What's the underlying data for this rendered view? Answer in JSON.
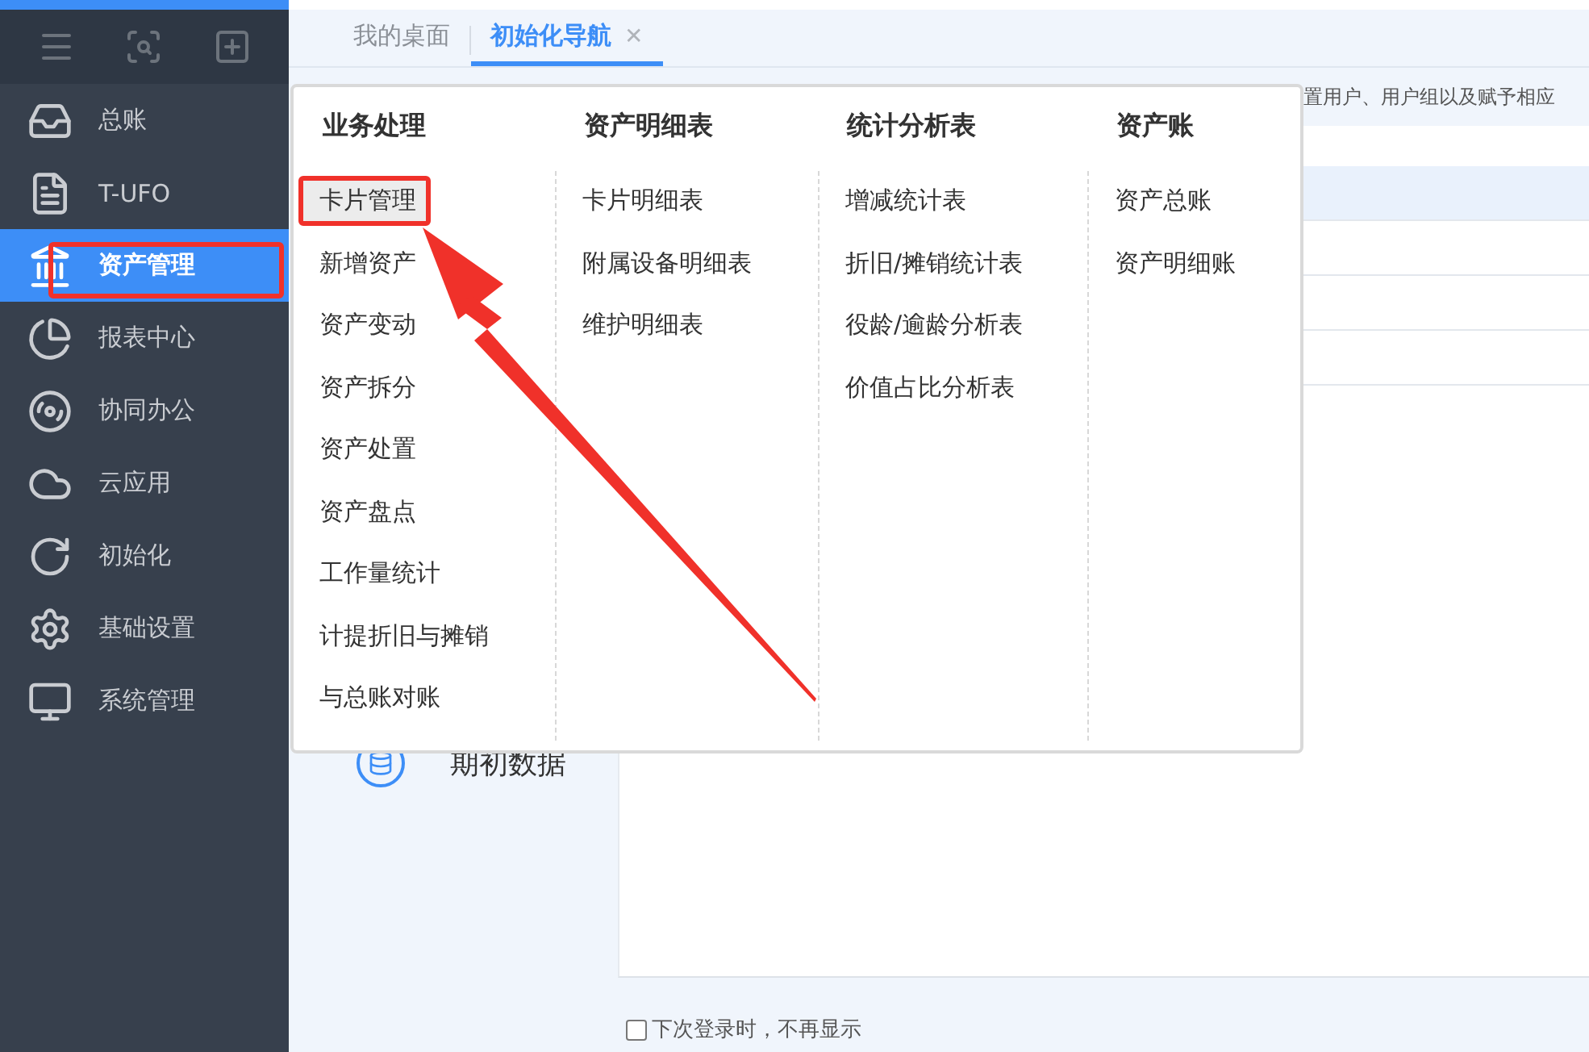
{
  "sidebar": {
    "items": [
      {
        "kind": "ledger",
        "label": "总账",
        "selected": false,
        "highlighted": false
      },
      {
        "kind": "report-file",
        "label": "T-UFO",
        "selected": false,
        "highlighted": false
      },
      {
        "kind": "bank",
        "label": "资产管理",
        "selected": true,
        "highlighted": true
      },
      {
        "kind": "pie",
        "label": "报表中心",
        "selected": false,
        "highlighted": false
      },
      {
        "kind": "collab",
        "label": "协同办公",
        "selected": false,
        "highlighted": false
      },
      {
        "kind": "cloud",
        "label": "云应用",
        "selected": false,
        "highlighted": false
      },
      {
        "kind": "refresh",
        "label": "初始化",
        "selected": false,
        "highlighted": false
      },
      {
        "kind": "gear",
        "label": "基础设置",
        "selected": false,
        "highlighted": false
      },
      {
        "kind": "monitor",
        "label": "系统管理",
        "selected": false,
        "highlighted": false
      }
    ]
  },
  "tabs": [
    {
      "label": "我的桌面",
      "selected": false,
      "closable": false
    },
    {
      "label": "初始化导航",
      "selected": true,
      "closable": true
    }
  ],
  "close_glyph": "✕",
  "notice": "置用户、用户组以及赋予相应",
  "left_nav": [
    {
      "label": "期初数据"
    }
  ],
  "footer": {
    "checkbox": {
      "label": "下次登录时，不再显示",
      "checked": false
    }
  },
  "menu": {
    "columns": [
      {
        "title": "业务处理",
        "items": [
          {
            "label": "卡片管理",
            "hovered": true,
            "highlighted": true
          },
          {
            "label": "新增资产",
            "hovered": false,
            "highlighted": false
          },
          {
            "label": "资产变动",
            "hovered": false,
            "highlighted": false
          },
          {
            "label": "资产拆分",
            "hovered": false,
            "highlighted": false
          },
          {
            "label": "资产处置",
            "hovered": false,
            "highlighted": false
          },
          {
            "label": "资产盘点",
            "hovered": false,
            "highlighted": false
          },
          {
            "label": "工作量统计",
            "hovered": false,
            "highlighted": false
          },
          {
            "label": "计提折旧与摊销",
            "hovered": false,
            "highlighted": false
          },
          {
            "label": "与总账对账",
            "hovered": false,
            "highlighted": false
          }
        ]
      },
      {
        "title": "资产明细表",
        "items": [
          {
            "label": "卡片明细表",
            "hovered": false,
            "highlighted": false
          },
          {
            "label": "附属设备明细表",
            "hovered": false,
            "highlighted": false
          },
          {
            "label": "维护明细表",
            "hovered": false,
            "highlighted": false
          }
        ]
      },
      {
        "title": "统计分析表",
        "items": [
          {
            "label": "增减统计表",
            "hovered": false,
            "highlighted": false
          },
          {
            "label": "折旧/摊销统计表",
            "hovered": false,
            "highlighted": false
          },
          {
            "label": "役龄/逾龄分析表",
            "hovered": false,
            "highlighted": false
          },
          {
            "label": "价值占比分析表",
            "hovered": false,
            "highlighted": false
          }
        ]
      },
      {
        "title": "资产账",
        "items": [
          {
            "label": "资产总账",
            "hovered": false,
            "highlighted": false
          },
          {
            "label": "资产明细账",
            "hovered": false,
            "highlighted": false
          }
        ]
      }
    ]
  }
}
